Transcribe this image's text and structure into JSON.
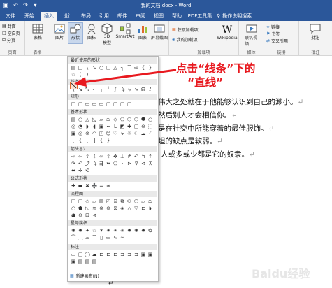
{
  "window": {
    "title": "我的文档.docx - Word"
  },
  "tabs": [
    "文件",
    "开始",
    "插入",
    "设计",
    "布局",
    "引用",
    "邮件",
    "审阅",
    "视图",
    "帮助",
    "PDF工具集"
  ],
  "active_tab": "插入",
  "tell_me": "操作说明搜索",
  "ribbon": {
    "pages": {
      "cover": "封面",
      "blank": "空白页",
      "break": "分页",
      "label": "页面"
    },
    "tables": {
      "table": "表格",
      "label": "表格"
    },
    "illustrations": {
      "picture": "图片",
      "shapes": "形状",
      "icons": "图标",
      "model3d": "3D",
      "model3d_2": "模型",
      "smartart": "SmartArt",
      "chart": "图表",
      "screenshot": "屏幕截图"
    },
    "addins": {
      "get": "获取加载项",
      "my": "我的加载项",
      "wikipedia": "Wikipedia",
      "label": "加载项"
    },
    "media": {
      "online_video": "联机视频",
      "label": "媒体"
    },
    "links": {
      "link": "链接",
      "bookmark": "书签",
      "crossref": "交叉引用",
      "label": "链接"
    },
    "comments": {
      "comment": "批注",
      "label": "批注"
    }
  },
  "dropdown": {
    "recent": "最近使用的形状",
    "lines": "线条",
    "rect": "矩形",
    "basic": "基本形状",
    "arrows": "箭头总汇",
    "equation": "公式形状",
    "flowchart": "流程图",
    "stars": "星与旗帜",
    "callouts": "标注",
    "new_canvas": "新建画布(N)"
  },
  "annotation": {
    "line1": "点击“线条”下的",
    "line2": "“直线”"
  },
  "document": {
    "lines": [
      "伟大之处就在于他能够认识到自己的渺小。",
      "然后别人才会相信你。",
      "是在社交中所能穿着的最佳服饰。",
      "坦的缺点是软弱。",
      "人或多或少都是它的奴隶。"
    ],
    "para_mark": "↵"
  },
  "watermark": "Baidu经验",
  "colors": {
    "word_blue": "#2b579a",
    "annotation_red": "#e8191f",
    "ribbon_bg": "#f3f3f3"
  }
}
